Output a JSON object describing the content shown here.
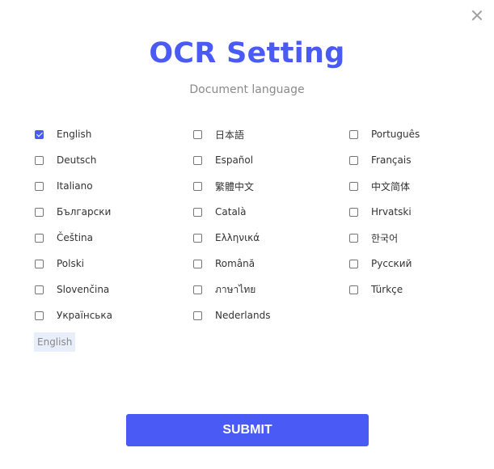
{
  "dialog": {
    "title": "OCR Setting",
    "subtitle": "Document language",
    "close_icon": "close-icon"
  },
  "languages": [
    {
      "label": "English",
      "checked": true
    },
    {
      "label": "日本語",
      "checked": false
    },
    {
      "label": "Português",
      "checked": false
    },
    {
      "label": "Deutsch",
      "checked": false
    },
    {
      "label": "Español",
      "checked": false
    },
    {
      "label": "Français",
      "checked": false
    },
    {
      "label": "Italiano",
      "checked": false
    },
    {
      "label": "繁體中文",
      "checked": false
    },
    {
      "label": "中文简体",
      "checked": false
    },
    {
      "label": "Български",
      "checked": false
    },
    {
      "label": "Català",
      "checked": false
    },
    {
      "label": "Hrvatski",
      "checked": false
    },
    {
      "label": "Čeština",
      "checked": false
    },
    {
      "label": "Ελληνικά",
      "checked": false
    },
    {
      "label": "한국어",
      "checked": false
    },
    {
      "label": "Polski",
      "checked": false
    },
    {
      "label": "Română",
      "checked": false
    },
    {
      "label": "Русский",
      "checked": false
    },
    {
      "label": "Slovenčina",
      "checked": false
    },
    {
      "label": "ภาษาไทย",
      "checked": false
    },
    {
      "label": "Türkçe",
      "checked": false
    },
    {
      "label": "Українська",
      "checked": false
    },
    {
      "label": "Nederlands",
      "checked": false
    }
  ],
  "selected_tags": [
    "English"
  ],
  "submit_label": "SUBMIT",
  "colors": {
    "accent": "#4a5bf5",
    "tag_bg": "#e8effb"
  }
}
